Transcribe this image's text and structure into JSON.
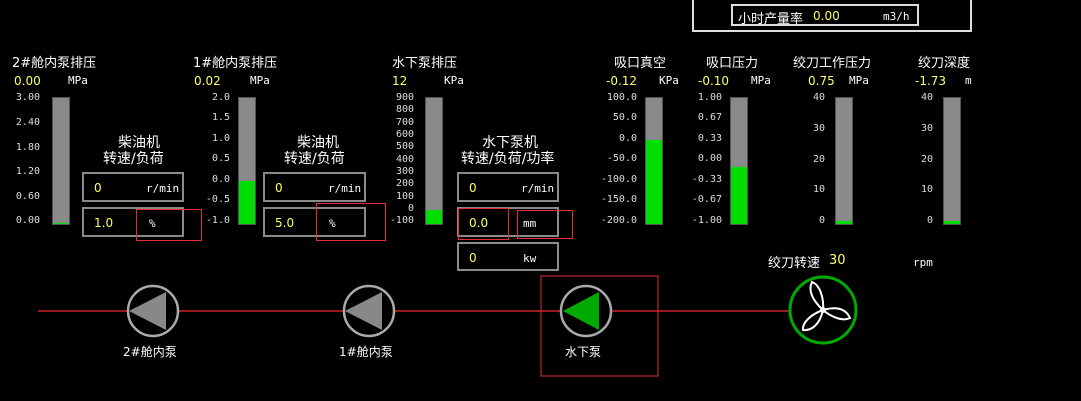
{
  "header": {
    "hourly_rate_label": "小时产量率",
    "hourly_rate_value": "0.00",
    "hourly_rate_unit": "m3/h"
  },
  "gauges": [
    {
      "title": "2#舱内泵排压",
      "value": "0.00",
      "unit": "MPa",
      "ticks": [
        "3.00",
        "2.40",
        "1.80",
        "1.20",
        "0.60",
        "0.00"
      ],
      "level": 0
    },
    {
      "title": "1#舱内泵排压",
      "value": "0.02",
      "unit": "MPa",
      "ticks": [
        "2.0",
        "1.5",
        "1.0",
        "0.5",
        "0.0",
        "-0.5",
        "-1.0"
      ],
      "level": 0.34
    },
    {
      "title": "水下泵排压",
      "value": "12",
      "unit": "KPa",
      "ticks": [
        "900",
        "800",
        "700",
        "600",
        "500",
        "400",
        "300",
        "200",
        "100",
        "0",
        "-100"
      ],
      "level": 0.11
    },
    {
      "title": "吸口真空",
      "value": "-0.12",
      "unit": "KPa",
      "ticks": [
        "100.0",
        "50.0",
        "0.0",
        "-50.0",
        "-100.0",
        "-150.0",
        "-200.0"
      ],
      "level": 0.67
    },
    {
      "title": "吸口压力",
      "value": "-0.10",
      "unit": "MPa",
      "ticks": [
        "1.00",
        "0.67",
        "0.33",
        "0.00",
        "-0.33",
        "-0.67",
        "-1.00"
      ],
      "level": 0.45
    },
    {
      "title": "绞刀工作压力",
      "value": "0.75",
      "unit": "MPa",
      "ticks": [
        "40",
        "30",
        "20",
        "10",
        "0"
      ],
      "level": 0.02
    },
    {
      "title": "绞刀深度",
      "value": "-1.73",
      "unit": "m",
      "ticks": [
        "40",
        "30",
        "20",
        "10",
        "0"
      ],
      "level": 0.02
    }
  ],
  "engine1": {
    "title_line1": "柴油机",
    "title_line2": "转速/负荷",
    "speed_value": "0",
    "speed_unit": "r/min",
    "load_value": "1.0",
    "load_unit": "%"
  },
  "engine2": {
    "title_line1": "柴油机",
    "title_line2": "转速/负荷",
    "speed_value": "0",
    "speed_unit": "r/min",
    "load_value": "5.0",
    "load_unit": "%"
  },
  "underwater_engine": {
    "title_line1": "水下泵机",
    "title_line2": "转速/负荷/功率",
    "speed_value": "0",
    "speed_unit": "r/min",
    "load_value": "0.0",
    "load_unit": "mm",
    "power_value": "0",
    "power_unit": "kw"
  },
  "cutter_speed": {
    "label": "绞刀转速",
    "value": "30",
    "unit": "rpm"
  },
  "pumps": {
    "pump2_label": "2#舱内泵",
    "pump1_label": "1#舱内泵",
    "underwater_label": "水下泵"
  },
  "colors": {
    "accent_green": "#00dd00",
    "value_yellow": "#ffff66",
    "pipe_red": "#cc2020",
    "box_red": "#e03030"
  }
}
